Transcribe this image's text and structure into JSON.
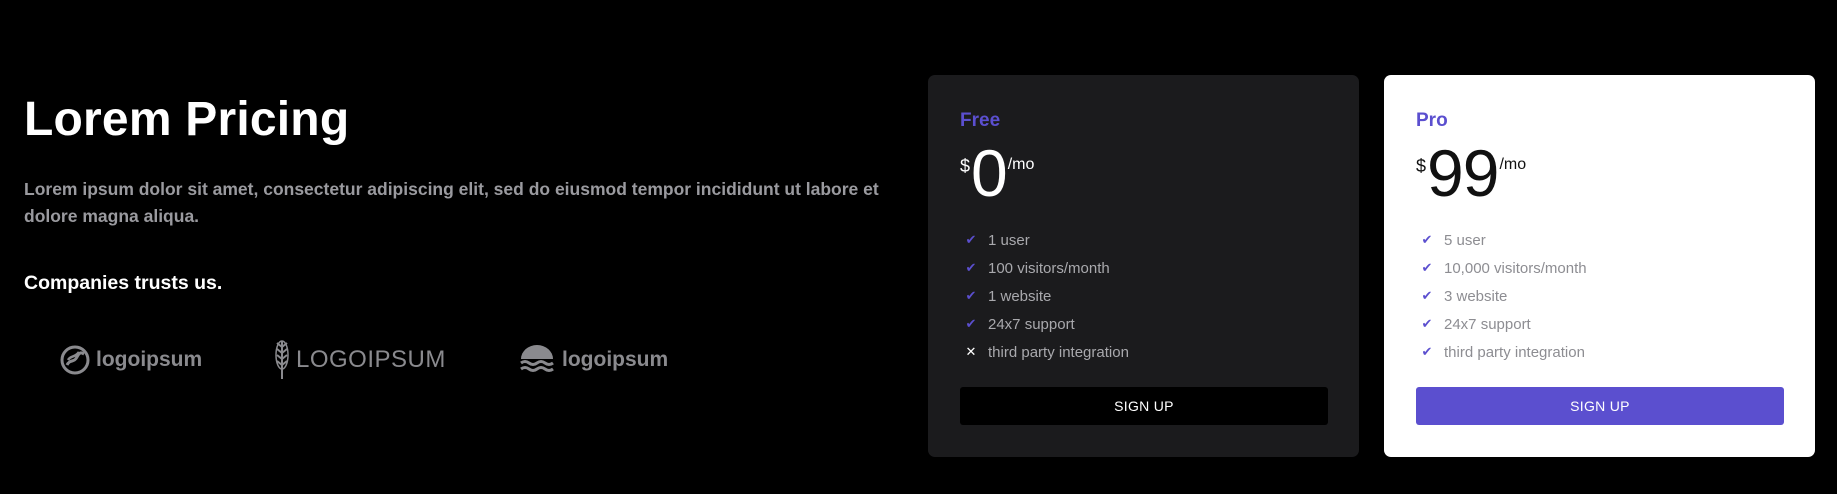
{
  "hero": {
    "title": "Lorem Pricing",
    "description": "Lorem ipsum dolor sit amet, consectetur adipiscing elit, sed do eiusmod tempor incididunt ut labore et dolore magna aliqua.",
    "companies_heading": "Companies trusts us."
  },
  "logos": [
    {
      "icon": "coffee-bean-logo-icon",
      "text": "logoipsum"
    },
    {
      "icon": "wheat-logo-icon",
      "text": "LOGOIPSUM"
    },
    {
      "icon": "waves-logo-icon",
      "text": "logoipsum"
    }
  ],
  "plans": {
    "free": {
      "name": "Free",
      "currency": "$",
      "amount": "0",
      "period": "/mo",
      "features": [
        {
          "label": "1 user",
          "included": true
        },
        {
          "label": "100 visitors/month",
          "included": true
        },
        {
          "label": "1 website",
          "included": true
        },
        {
          "label": "24x7 support",
          "included": true
        },
        {
          "label": "third party integration",
          "included": false
        }
      ],
      "button": "SIGN UP"
    },
    "pro": {
      "name": "Pro",
      "currency": "$",
      "amount": "99",
      "period": "/mo",
      "features": [
        {
          "label": "5 user",
          "included": true
        },
        {
          "label": "10,000 visitors/month",
          "included": true
        },
        {
          "label": "3 website",
          "included": true
        },
        {
          "label": "24x7 support",
          "included": true
        },
        {
          "label": "third party integration",
          "included": true
        }
      ],
      "button": "SIGN UP"
    }
  },
  "colors": {
    "background": "#000000",
    "accent": "#5b4fcf",
    "free_card": "#1b1b1d",
    "pro_card": "#ffffff",
    "muted_text": "#9a9a9f"
  }
}
